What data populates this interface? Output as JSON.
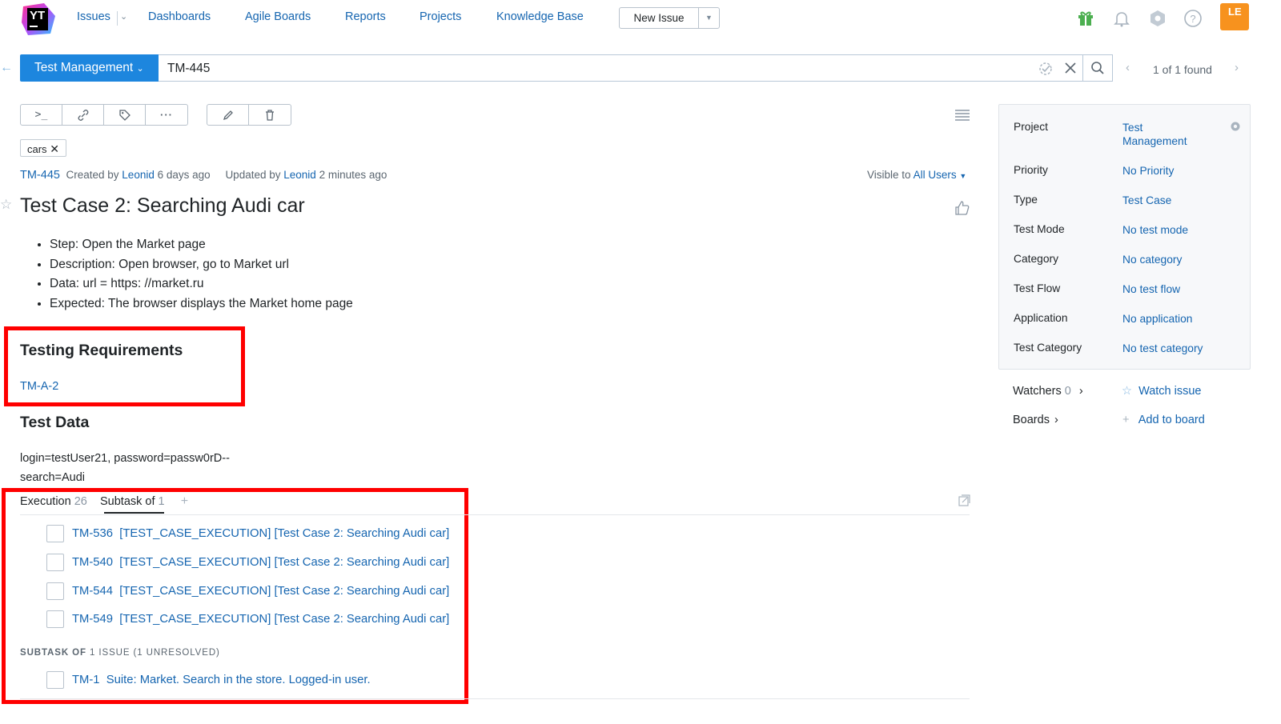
{
  "nav": {
    "logo_text": "YT",
    "items": [
      "Issues",
      "Dashboards",
      "Agile Boards",
      "Reports",
      "Projects",
      "Knowledge Base"
    ],
    "new_issue": "New Issue",
    "avatar": "LE"
  },
  "search": {
    "project": "Test Management",
    "query": "TM-445",
    "found": "1 of 1 found"
  },
  "issue": {
    "tag": "cars",
    "id": "TM-445",
    "created_prefix": "Created by",
    "created_by": "Leonid",
    "created_when": "6 days ago",
    "updated_prefix": "Updated by",
    "updated_by": "Leonid",
    "updated_when": "2 minutes ago",
    "visible_prefix": "Visible to",
    "visible_to": "All Users",
    "title": "Test Case 2: Searching Audi car",
    "steps": [
      "Step: Open the Market page",
      "Description: Open browser, go to Market url",
      "Data: url = https: //market.ru",
      "Expected: The browser displays the Market home page"
    ],
    "req_heading": "Testing Requirements",
    "req_link": "TM-A-2",
    "data_heading": "Test Data",
    "data_line1": "login=testUser21, password=passw0rD--",
    "data_line2": "search=Audi"
  },
  "links": {
    "tab1_label": "Execution",
    "tab1_count": "26",
    "tab2_label": "Subtask of",
    "tab2_count": "1",
    "add": "+",
    "executions": [
      {
        "id": "TM-536",
        "summary": "[TEST_CASE_EXECUTION] [Test Case 2: Searching Audi car]"
      },
      {
        "id": "TM-540",
        "summary": "[TEST_CASE_EXECUTION] [Test Case 2: Searching Audi car]"
      },
      {
        "id": "TM-544",
        "summary": "[TEST_CASE_EXECUTION] [Test Case 2: Searching Audi car]"
      },
      {
        "id": "TM-549",
        "summary": "[TEST_CASE_EXECUTION] [Test Case 2: Searching Audi car]"
      }
    ],
    "subtask_caption_bold": "SUBTASK OF",
    "subtask_caption_rest": "1 ISSUE (1 UNRESOLVED)",
    "parent": {
      "id": "TM-1",
      "summary": "Suite: Market. Search in the store. Logged-in user."
    }
  },
  "fields": {
    "project_label": "Project",
    "project_value_1": "Test",
    "project_value_2": "Management",
    "rows": [
      {
        "label": "Priority",
        "value": "No Priority"
      },
      {
        "label": "Type",
        "value": "Test Case"
      },
      {
        "label": "Test Mode",
        "value": "No test mode"
      },
      {
        "label": "Category",
        "value": "No category"
      },
      {
        "label": "Test Flow",
        "value": "No test flow"
      },
      {
        "label": "Application",
        "value": "No application"
      },
      {
        "label": "Test Category",
        "value": "No test category"
      }
    ]
  },
  "sidebar": {
    "watchers_label": "Watchers",
    "watchers_count": "0",
    "watch_issue": "Watch issue",
    "boards_label": "Boards",
    "add_to_board": "Add to board"
  },
  "colors": {
    "accent": "#1d86de",
    "link": "#1565b0",
    "highlight_box": "#ff0000",
    "avatar": "#f7921e"
  }
}
